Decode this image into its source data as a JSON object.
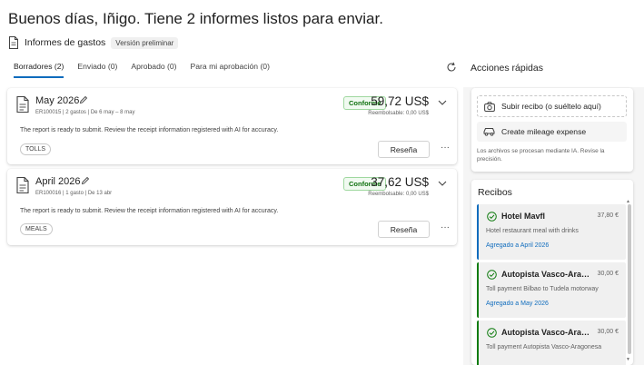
{
  "header": {
    "greeting": "Buenos días, Iñigo. Tiene 2 informes listos para enviar.",
    "section_title": "Informes de gastos",
    "preview_badge": "Versión preliminar"
  },
  "tabs": [
    {
      "label": "Borradores (2)",
      "active": true
    },
    {
      "label": "Enviado (0)",
      "active": false
    },
    {
      "label": "Aprobado (0)",
      "active": false
    },
    {
      "label": "Para mi aprobación (0)",
      "active": false
    }
  ],
  "reports": [
    {
      "month": "May 2026",
      "meta": "ER100015 | 2 gastos | De 6 may – 8 may",
      "status": "Conforme",
      "amount": "59,72 US$",
      "reimbursable": "Reembolsable: 0,00 US$",
      "note": "The report is ready to submit. Review the receipt information registered with AI for accuracy.",
      "tag": "TOLLS",
      "review_label": "Reseña",
      "more_label": "···"
    },
    {
      "month": "April 2026",
      "meta": "ER100016 | 1 gasto | De 13 abr",
      "status": "Conforme",
      "amount": "37,62 US$",
      "reimbursable": "Reembolsable: 0,00 US$",
      "note": "The report is ready to submit. Review the receipt information registered with AI for accuracy.",
      "tag": "MEALS",
      "review_label": "Reseña",
      "more_label": "···"
    }
  ],
  "quick_actions": {
    "title": "Acciones rápidas",
    "upload_label": "Subir recibo (o suéltelo aquí)",
    "mileage_label": "Create mileage expense",
    "note": "Los archivos se procesan mediante IA. Revise la precisión."
  },
  "receipts": {
    "title": "Recibos",
    "items": [
      {
        "name": "Hotel Mavfl",
        "amount": "37,80 €",
        "desc": "Hotel restaurant meal with drinks",
        "link": "Agregado a April 2026",
        "accent": "#0f6cbd"
      },
      {
        "name": "Autopista Vasco-Aragonesa",
        "amount": "30,00 €",
        "desc": "Toll payment Bilbao to Tudela motorway",
        "link": "Agregado a May 2026",
        "accent": "#107c10"
      },
      {
        "name": "Autopista Vasco-Aragonesa",
        "amount": "30,00 €",
        "desc": "Toll payment Autopista Vasco-Aragonesa",
        "link": "",
        "accent": "#107c10"
      }
    ]
  },
  "colors": {
    "accent": "#0f6cbd",
    "success": "#0e700e"
  },
  "icons": {
    "document": "document-icon",
    "edit": "pencil-icon",
    "chevron": "chevron-down-icon",
    "refresh": "refresh-icon",
    "camera": "camera-icon",
    "car": "car-icon",
    "check": "check-circle-icon"
  }
}
